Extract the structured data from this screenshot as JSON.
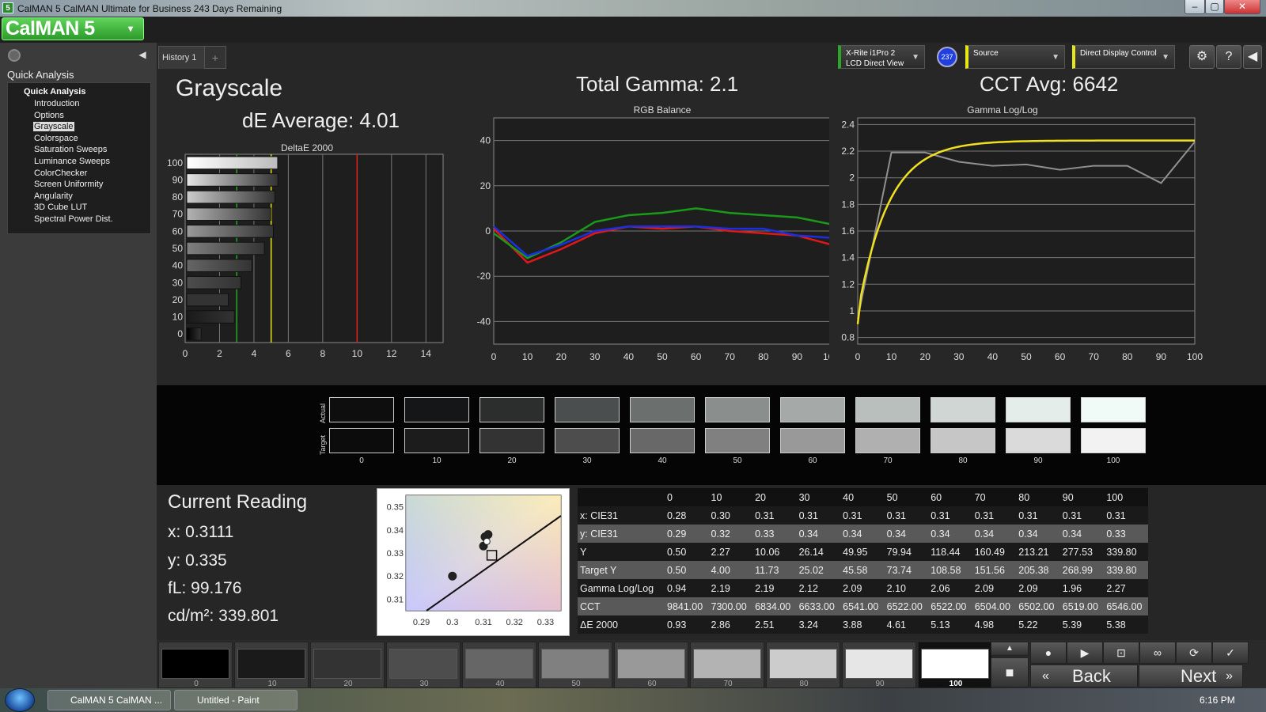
{
  "window": {
    "title": "CalMAN 5 CalMAN Ultimate for Business 243 Days Remaining",
    "app_icon": "5",
    "buttons": [
      "minimize-icon",
      "maximize-icon",
      "close-icon"
    ]
  },
  "brand": {
    "logo": "CalMAN 5",
    "dropdown_glyph": "▾"
  },
  "sidebar": {
    "heading": "Quick Analysis",
    "group": "Quick Analysis",
    "items": [
      {
        "label": "Introduction"
      },
      {
        "label": "Options"
      },
      {
        "label": "Grayscale",
        "selected": true
      },
      {
        "label": "Colorspace"
      },
      {
        "label": "Saturation Sweeps"
      },
      {
        "label": "Luminance Sweeps"
      },
      {
        "label": "ColorChecker"
      },
      {
        "label": "Screen Uniformity"
      },
      {
        "label": "Angularity"
      },
      {
        "label": "3D Cube LUT"
      },
      {
        "label": "Spectral Power Dist."
      }
    ]
  },
  "tabs": {
    "history": "History 1",
    "add": "+"
  },
  "toolbar": {
    "meter_line1": "X-Rite i1Pro 2",
    "meter_line2": "LCD Direct View",
    "meter_badge": "237",
    "source": "Source",
    "display_control": "Direct Display Control",
    "meter_color": "#2ca52a",
    "source_color": "#e6e619",
    "display_color": "#e6e619"
  },
  "summary": {
    "page_title": "Grayscale",
    "de_average": "dE Average: 4.01",
    "total_gamma": "Total Gamma: 2.1",
    "cct_avg": "CCT Avg: 6642"
  },
  "chart_data": [
    {
      "type": "bar",
      "title": "DeltaE 2000",
      "orientation": "horizontal",
      "categories": [
        "0",
        "10",
        "20",
        "30",
        "40",
        "50",
        "60",
        "70",
        "80",
        "90",
        "100"
      ],
      "values": [
        0.93,
        2.86,
        2.51,
        3.24,
        3.88,
        4.61,
        5.13,
        4.98,
        5.22,
        5.39,
        5.38
      ],
      "xlim": [
        0,
        15
      ],
      "xticks": [
        0,
        2,
        4,
        6,
        8,
        10,
        12,
        14
      ],
      "thresholds": [
        {
          "value": 3,
          "color": "#22aa22"
        },
        {
          "value": 5,
          "color": "#e6e619"
        },
        {
          "value": 10,
          "color": "#e02020"
        }
      ]
    },
    {
      "type": "line",
      "title": "RGB Balance",
      "x": [
        0,
        10,
        20,
        30,
        40,
        50,
        60,
        70,
        80,
        90,
        100
      ],
      "ylim": [
        -50,
        50
      ],
      "yticks": [
        40,
        20,
        0,
        -20,
        -40
      ],
      "series": [
        {
          "color": "#e01818",
          "values": [
            1,
            -14,
            -8,
            -1,
            2,
            1,
            2,
            0,
            -1,
            -2,
            -6
          ]
        },
        {
          "color": "#1a9a1a",
          "values": [
            -1,
            -12,
            -5,
            4,
            7,
            8,
            10,
            8,
            7,
            6,
            3
          ]
        },
        {
          "color": "#1a30e0",
          "values": [
            2,
            -11,
            -6,
            0,
            2,
            2,
            2,
            1,
            1,
            -2,
            -3
          ]
        }
      ]
    },
    {
      "type": "line",
      "title": "Gamma Log/Log",
      "x": [
        0,
        10,
        20,
        30,
        40,
        50,
        60,
        70,
        80,
        90,
        100
      ],
      "ylim": [
        0.75,
        2.45
      ],
      "yticks": [
        2.4,
        2.2,
        2,
        1.8,
        1.6,
        1.4,
        1.2,
        1,
        0.8
      ],
      "series": [
        {
          "color": "#909090",
          "values": [
            0.94,
            2.19,
            2.19,
            2.12,
            2.09,
            2.1,
            2.06,
            2.09,
            2.09,
            1.96,
            2.27
          ]
        },
        {
          "color": "#f0e020",
          "function": "target-gamma-curve"
        }
      ]
    },
    {
      "type": "scatter",
      "title": "CIE xy",
      "xticks": [
        0.29,
        0.3,
        0.31,
        0.32,
        0.33
      ],
      "yticks": [
        0.35,
        0.34,
        0.33,
        0.32,
        0.31
      ],
      "xlim": [
        0.285,
        0.335
      ],
      "ylim": [
        0.305,
        0.355
      ],
      "points": [
        {
          "x": 0.3,
          "y": 0.32
        },
        {
          "x": 0.31,
          "y": 0.333
        },
        {
          "x": 0.3105,
          "y": 0.337
        },
        {
          "x": 0.3115,
          "y": 0.338
        },
        {
          "x": 0.3111,
          "y": 0.335
        }
      ],
      "target": {
        "x": 0.3127,
        "y": 0.329
      }
    }
  ],
  "swatches": {
    "row_actual": "Actual",
    "row_target": "Target",
    "labels": [
      "0",
      "10",
      "20",
      "30",
      "40",
      "50",
      "60",
      "70",
      "80",
      "90",
      "100"
    ],
    "actual": [
      "#0e0e0e",
      "#151617",
      "#2c2e2e",
      "#4a4e4e",
      "#6b6f6e",
      "#8a8e8d",
      "#a5aaa8",
      "#b9bfbc",
      "#cfd6d3",
      "#e4ede9",
      "#f0fbf7"
    ],
    "target": [
      "#0c0c0c",
      "#1c1c1c",
      "#333333",
      "#4d4d4d",
      "#686868",
      "#808080",
      "#999999",
      "#b0b0b0",
      "#c6c6c6",
      "#dadada",
      "#f2f2f2"
    ]
  },
  "current_reading": {
    "title": "Current Reading",
    "x": "x: 0.3111",
    "y": "y: 0.335",
    "fl": "fL: 99.176",
    "cdm2": "cd/m²: 339.801"
  },
  "table": {
    "columns": [
      "",
      "0",
      "10",
      "20",
      "30",
      "40",
      "50",
      "60",
      "70",
      "80",
      "90",
      "100"
    ],
    "rows": [
      [
        "x: CIE31",
        "0.28",
        "0.30",
        "0.31",
        "0.31",
        "0.31",
        "0.31",
        "0.31",
        "0.31",
        "0.31",
        "0.31",
        "0.31"
      ],
      [
        "y: CIE31",
        "0.29",
        "0.32",
        "0.33",
        "0.34",
        "0.34",
        "0.34",
        "0.34",
        "0.34",
        "0.34",
        "0.34",
        "0.33"
      ],
      [
        "Y",
        "0.50",
        "2.27",
        "10.06",
        "26.14",
        "49.95",
        "79.94",
        "118.44",
        "160.49",
        "213.21",
        "277.53",
        "339.80"
      ],
      [
        "Target Y",
        "0.50",
        "4.00",
        "11.73",
        "25.02",
        "45.58",
        "73.74",
        "108.58",
        "151.56",
        "205.38",
        "268.99",
        "339.80"
      ],
      [
        "Gamma Log/Log",
        "0.94",
        "2.19",
        "2.19",
        "2.12",
        "2.09",
        "2.10",
        "2.06",
        "2.09",
        "2.09",
        "1.96",
        "2.27"
      ],
      [
        "CCT",
        "9841.00",
        "7300.00",
        "6834.00",
        "6633.00",
        "6541.00",
        "6522.00",
        "6522.00",
        "6504.00",
        "6502.00",
        "6519.00",
        "6546.00"
      ],
      [
        "ΔE 2000",
        "0.93",
        "2.86",
        "2.51",
        "3.24",
        "3.88",
        "4.61",
        "5.13",
        "4.98",
        "5.22",
        "5.39",
        "5.38"
      ]
    ]
  },
  "bottom": {
    "labels": [
      "0",
      "10",
      "20",
      "30",
      "40",
      "50",
      "60",
      "70",
      "80",
      "90",
      "100"
    ],
    "colors": [
      "#000000",
      "#1a1a1a",
      "#333333",
      "#4d4d4d",
      "#666666",
      "#808080",
      "#999999",
      "#b3b3b3",
      "#cccccc",
      "#e6e6e6",
      "#ffffff"
    ],
    "selected_index": 10,
    "back": "Back",
    "next": "Next"
  },
  "taskbar": {
    "task1": "CalMAN 5 CalMAN ...",
    "task2": "Untitled - Paint",
    "clock": "6:16 PM"
  }
}
